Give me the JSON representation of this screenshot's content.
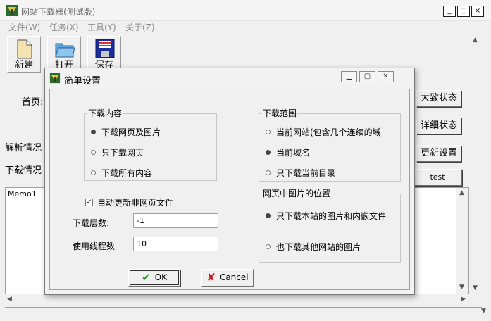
{
  "window": {
    "title": "网站下载器(测试版)",
    "minimize_label": "_",
    "restore_label": "□",
    "close_label": "×"
  },
  "menu": [
    "文件(W)",
    "任务(X)",
    "工具(Y)",
    "关于(Z)"
  ],
  "toolbar": {
    "new_label": "新建",
    "open_label": "打开",
    "save_label": "保存"
  },
  "main": {
    "homepage_label": "首页:",
    "parse_label": "解析情况",
    "download_label": "下载情况",
    "buttons": [
      "大致状态",
      "详细状态",
      "更新设置",
      "test"
    ],
    "memo_text": "Memo1"
  },
  "dialog": {
    "title": "简单设置",
    "content_group": {
      "title": "下载内容",
      "options": [
        "下载网页及图片",
        "只下载网页",
        "下载所有内容"
      ],
      "selected": 0
    },
    "range_group": {
      "title": "下载范围",
      "options": [
        "当前网站(包含几个连续的域",
        "当前域名",
        "只下载当前目录"
      ],
      "selected": 1
    },
    "image_group": {
      "title": "网页中图片的位置",
      "options": [
        "只下载本站的图片和内嵌文件",
        "也下载其他网站的图片"
      ],
      "selected": 0
    },
    "auto_update_label": "自动更新非网页文件",
    "auto_update_checked": true,
    "depth_label": "下载层数:",
    "depth_value": "-1",
    "threads_label": "使用线程数",
    "threads_value": "10",
    "ok_label": "OK",
    "cancel_label": "Cancel"
  },
  "colors": {
    "ok_check": "#1e9a1e",
    "cancel_x": "#c62020"
  }
}
